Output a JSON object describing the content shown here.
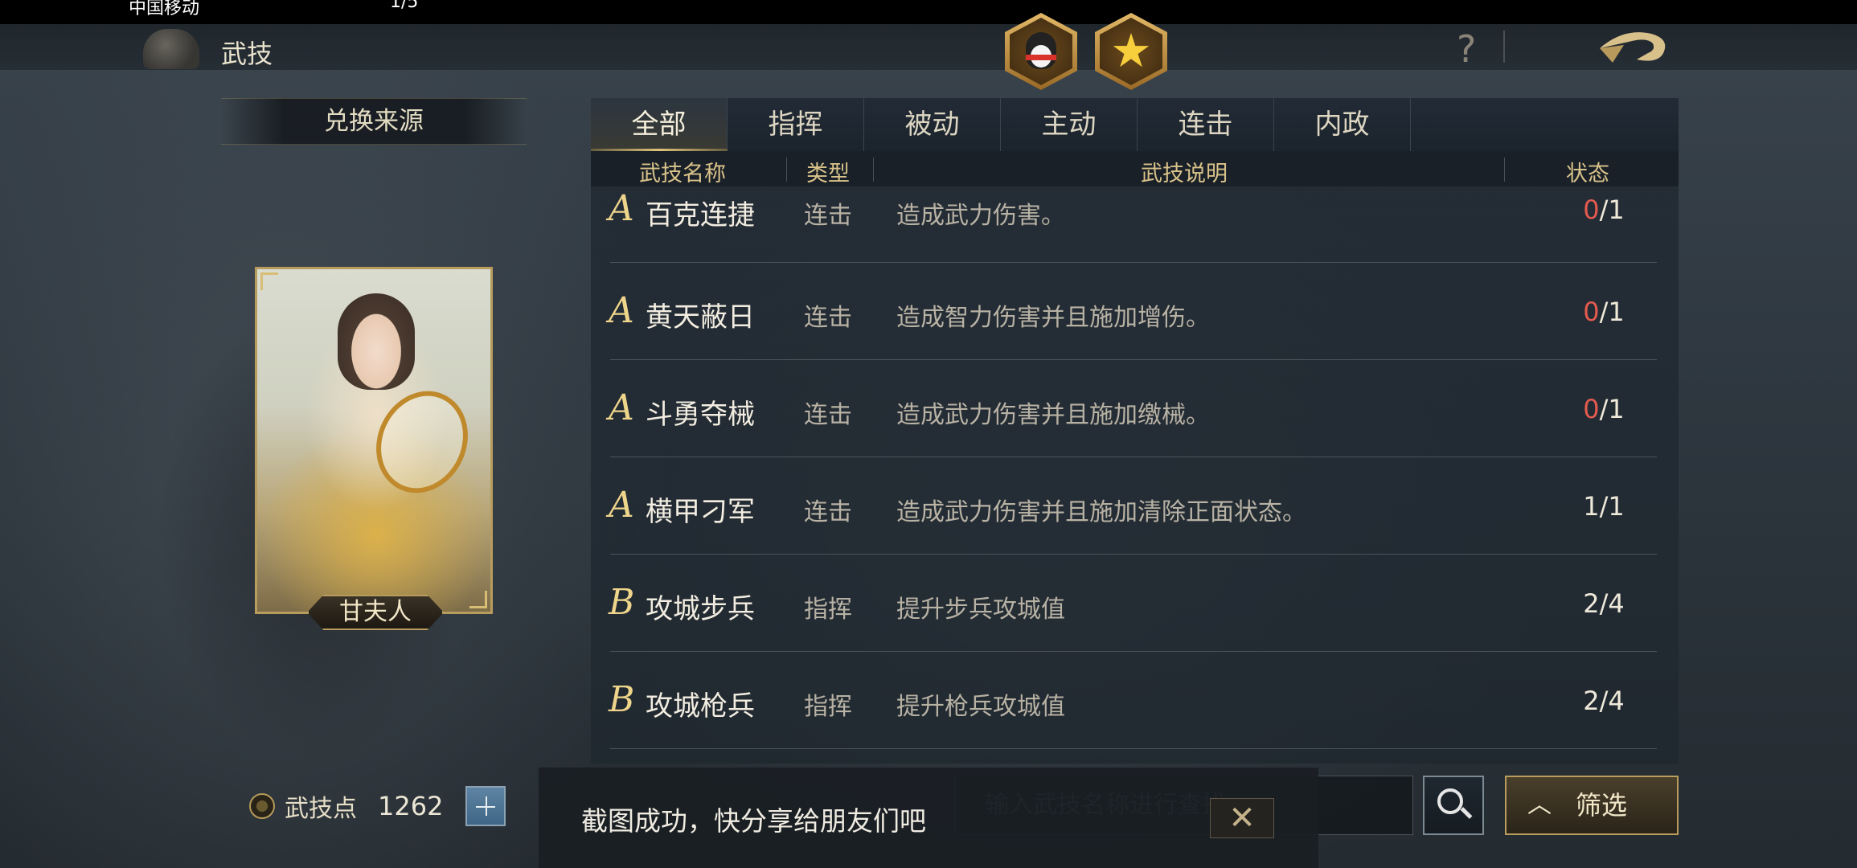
{
  "status_bar": {
    "carrier": "中国移动",
    "right_text": "1/5"
  },
  "header": {
    "title": "武技",
    "help_icon": "?"
  },
  "left": {
    "source_label": "兑换来源",
    "hero_name": "甘夫人",
    "skill_points_label": "武技点",
    "skill_points_value": "1262"
  },
  "tabs": [
    {
      "label": "全部",
      "active": true
    },
    {
      "label": "指挥",
      "active": false
    },
    {
      "label": "被动",
      "active": false
    },
    {
      "label": "主动",
      "active": false
    },
    {
      "label": "连击",
      "active": false
    },
    {
      "label": "内政",
      "active": false
    }
  ],
  "columns": {
    "name": "武技名称",
    "type": "类型",
    "desc": "武技说明",
    "status": "状态"
  },
  "rows": [
    {
      "grade": "A",
      "name": "百克连捷",
      "type": "连击",
      "desc": "造成武力伤害。",
      "owned": "0",
      "total": "/1"
    },
    {
      "grade": "A",
      "name": "黄天蔽日",
      "type": "连击",
      "desc": "造成智力伤害并且施加增伤。",
      "owned": "0",
      "total": "/1"
    },
    {
      "grade": "A",
      "name": "斗勇夺械",
      "type": "连击",
      "desc": "造成武力伤害并且施加缴械。",
      "owned": "0",
      "total": "/1"
    },
    {
      "grade": "A",
      "name": "横甲刁军",
      "type": "连击",
      "desc": "造成武力伤害并且施加清除正面状态。",
      "owned": "1",
      "total": "/1"
    },
    {
      "grade": "B",
      "name": "攻城步兵",
      "type": "指挥",
      "desc": "提升步兵攻城值",
      "owned": "2",
      "total": "/4"
    },
    {
      "grade": "B",
      "name": "攻城枪兵",
      "type": "指挥",
      "desc": "提升枪兵攻城值",
      "owned": "2",
      "total": "/4"
    }
  ],
  "search": {
    "placeholder": "输入武技名称进行查找"
  },
  "filter_label": "筛选",
  "toast": {
    "message": "截图成功，快分享给朋友们吧",
    "close": "✕"
  },
  "colors": {
    "accent_gold": "#d9c38a",
    "zero_red": "#e45a4f",
    "grade_gold": "#eed58b"
  }
}
